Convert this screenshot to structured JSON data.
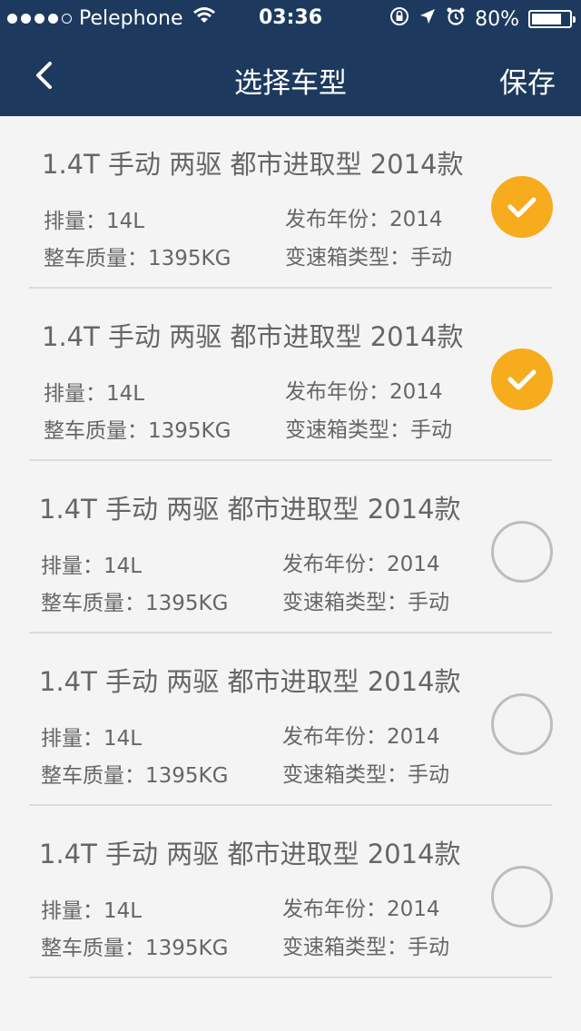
{
  "status_bar": {
    "carrier": "Pelephone",
    "time": "03:36",
    "battery": "80%",
    "battery_level": 0.8,
    "signal_bars_filled": 4,
    "signal_bars_total": 5
  },
  "nav": {
    "title": "选择车型",
    "save_label": "保存"
  },
  "colors": {
    "nav_bg": "#1d3a5e",
    "selected": "#f7ac1d",
    "unselected_ring": "#bdbdbd"
  },
  "items": [
    {
      "title": "1.4T 手动 两驱 都市进取型 2014款",
      "displacement": "排量：14L",
      "year": "发布年份：2014",
      "weight": "整车质量：1395KG",
      "gearbox": "变速箱类型：手动",
      "selected": true
    },
    {
      "title": "1.4T 手动 两驱 都市进取型 2014款",
      "displacement": "排量：14L",
      "year": "发布年份：2014",
      "weight": "整车质量：1395KG",
      "gearbox": "变速箱类型：手动",
      "selected": true
    },
    {
      "title": "1.4T 手动 两驱 都市进取型 2014款",
      "displacement": "排量：14L",
      "year": "发布年份：2014",
      "weight": "整车质量：1395KG",
      "gearbox": "变速箱类型：手动",
      "selected": false
    },
    {
      "title": "1.4T 手动 两驱 都市进取型 2014款",
      "displacement": "排量：14L",
      "year": "发布年份：2014",
      "weight": "整车质量：1395KG",
      "gearbox": "变速箱类型：手动",
      "selected": false
    },
    {
      "title": "1.4T 手动 两驱 都市进取型 2014款",
      "displacement": "排量：14L",
      "year": "发布年份：2014",
      "weight": "整车质量：1395KG",
      "gearbox": "变速箱类型：手动",
      "selected": false
    }
  ]
}
